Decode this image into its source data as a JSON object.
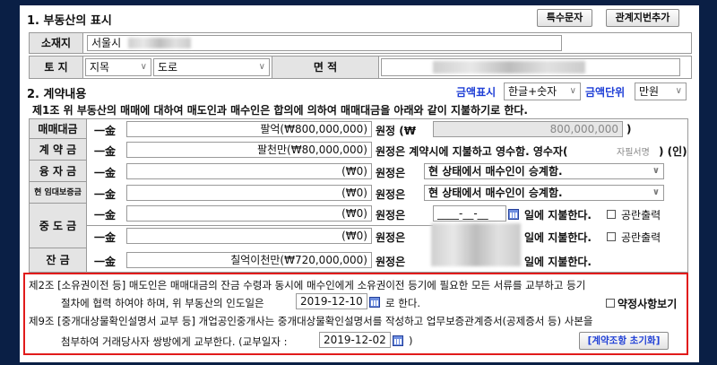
{
  "section1": {
    "title": "1. 부동산의 표시",
    "btn_special": "특수문자",
    "btn_related": "관계지번추가",
    "location_label": "소재지",
    "location_value": "서울시",
    "land_label": "토 지",
    "land_category": "지목",
    "land_use": "도로",
    "area_label": "면 적"
  },
  "section2": {
    "title": "2. 계약내용",
    "amount_display_label": "금액표시",
    "amount_display_value": "한글+숫자",
    "amount_unit_label": "금액단위",
    "amount_unit_value": "만원",
    "article1": "제1조 위 부동산의 매매에 대하여 매도인과 매수인은 합의에 의하여 매매대금을 아래와 같이 지불하기로 한다."
  },
  "payments": {
    "sale": {
      "label": "매매대금",
      "prefix": "一金",
      "amount": "팔억(₩800,000,000)",
      "won": "원정 (₩",
      "numeric": "800,000,000",
      "close": ")"
    },
    "deposit": {
      "label": "계 약 금",
      "prefix": "一金",
      "amount": "팔천만(₩80,000,000)",
      "text": "원정은 계약시에 지불하고 영수함. 영수자(",
      "signature": "자필서명",
      "text_end": ") (인)"
    },
    "loan": {
      "label": "융 자 금",
      "prefix": "一金",
      "amount": "(₩0)",
      "won": "원정은",
      "option": "현 상태에서 매수인이 승계함."
    },
    "lease": {
      "label": "현 임대보증금",
      "prefix": "一金",
      "amount": "(₩0)",
      "won": "원정은",
      "option": "현 상태에서 매수인이 승계함."
    },
    "middle": {
      "label": "중 도 금",
      "prefix": "一金",
      "rows": [
        {
          "amount": "(₩0)",
          "won": "원정은",
          "date": "____-__-__",
          "pay_text": "일에 지불한다.",
          "check": "공란출력"
        },
        {
          "amount": "(₩0)",
          "won": "원정은",
          "pay_text": "일에 지불한다.",
          "check": "공란출력"
        }
      ]
    },
    "balance": {
      "label": "잔 금",
      "prefix": "一金",
      "amount": "칠억이천만(₩720,000,000)",
      "won": "원정은",
      "pay_text": "일에 지불한다."
    }
  },
  "article2": {
    "line1": "제2조 [소유권이전 등] 매도인은 매매대금의 잔금 수령과 동시에 매수인에게 소유권이전 등기에 필요한 모든 서류를 교부하고  등기",
    "line2a": "절차에 협력 하여야 하며,  위 부동산의 인도일은",
    "date": "2019-12-10",
    "line2b": "로 한다.",
    "special_terms": "약정사항보기"
  },
  "article9": {
    "line1": "제9조 [중개대상물확인설명서 교부 등] 개업공인중개사는 중개대상물확인설명서를 작성하고 업무보증관계증서(공제증서 등) 사본을",
    "line2a": "첨부하여 거래당사자 쌍방에게 교부한다. (교부일자 :",
    "date": "2019-12-02",
    "line2b": ")",
    "reset_button": "[계약조항 초기화]"
  }
}
